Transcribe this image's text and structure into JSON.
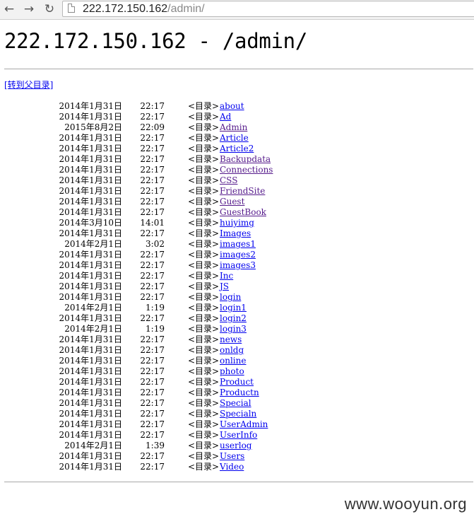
{
  "browser": {
    "back_icon": "←",
    "forward_icon": "→",
    "reload_icon": "↻",
    "url_host": "222.172.150.162",
    "url_path": "/admin/"
  },
  "page": {
    "title": "222.172.150.162 - /admin/",
    "parent_link": "[转到父目录]",
    "dir_tag": "<目录>",
    "watermark": "www.wooyun.org"
  },
  "entries": [
    {
      "date": "2014年1月31日",
      "time": "22:17",
      "name": "about"
    },
    {
      "date": "2014年1月31日",
      "time": "22:17",
      "name": "Ad"
    },
    {
      "date": "2015年8月2日",
      "time": "22:09",
      "name": "Admin"
    },
    {
      "date": "2014年1月31日",
      "time": "22:17",
      "name": "Article"
    },
    {
      "date": "2014年1月31日",
      "time": "22:17",
      "name": "Article2"
    },
    {
      "date": "2014年1月31日",
      "time": "22:17",
      "name": "Backupdata"
    },
    {
      "date": "2014年1月31日",
      "time": "22:17",
      "name": "Connections"
    },
    {
      "date": "2014年1月31日",
      "time": "22:17",
      "name": "CSS"
    },
    {
      "date": "2014年1月31日",
      "time": "22:17",
      "name": "FriendSite"
    },
    {
      "date": "2014年1月31日",
      "time": "22:17",
      "name": "Guest"
    },
    {
      "date": "2014年1月31日",
      "time": "22:17",
      "name": "GuestBook"
    },
    {
      "date": "2014年3月10日",
      "time": "14:01",
      "name": "huiyimg"
    },
    {
      "date": "2014年1月31日",
      "time": "22:17",
      "name": "Images"
    },
    {
      "date": "2014年2月1日",
      "time": "3:02",
      "name": "images1"
    },
    {
      "date": "2014年1月31日",
      "time": "22:17",
      "name": "images2"
    },
    {
      "date": "2014年1月31日",
      "time": "22:17",
      "name": "images3"
    },
    {
      "date": "2014年1月31日",
      "time": "22:17",
      "name": "Inc"
    },
    {
      "date": "2014年1月31日",
      "time": "22:17",
      "name": "JS"
    },
    {
      "date": "2014年1月31日",
      "time": "22:17",
      "name": "login"
    },
    {
      "date": "2014年2月1日",
      "time": "1:19",
      "name": "login1"
    },
    {
      "date": "2014年1月31日",
      "time": "22:17",
      "name": "login2"
    },
    {
      "date": "2014年2月1日",
      "time": "1:19",
      "name": "login3"
    },
    {
      "date": "2014年1月31日",
      "time": "22:17",
      "name": "news"
    },
    {
      "date": "2014年1月31日",
      "time": "22:17",
      "name": "onldg"
    },
    {
      "date": "2014年1月31日",
      "time": "22:17",
      "name": "online"
    },
    {
      "date": "2014年1月31日",
      "time": "22:17",
      "name": "photo"
    },
    {
      "date": "2014年1月31日",
      "time": "22:17",
      "name": "Product"
    },
    {
      "date": "2014年1月31日",
      "time": "22:17",
      "name": "Productn"
    },
    {
      "date": "2014年1月31日",
      "time": "22:17",
      "name": "Special"
    },
    {
      "date": "2014年1月31日",
      "time": "22:17",
      "name": "Specialn"
    },
    {
      "date": "2014年1月31日",
      "time": "22:17",
      "name": "UserAdmin"
    },
    {
      "date": "2014年1月31日",
      "time": "22:17",
      "name": "UserInfo"
    },
    {
      "date": "2014年2月1日",
      "time": "1:39",
      "name": "userlog"
    },
    {
      "date": "2014年1月31日",
      "time": "22:17",
      "name": "Users"
    },
    {
      "date": "2014年1月31日",
      "time": "22:17",
      "name": "Video"
    }
  ],
  "visited": [
    "Admin",
    "Backupdata",
    "Connections",
    "CSS",
    "FriendSite",
    "Guest",
    "GuestBook"
  ]
}
